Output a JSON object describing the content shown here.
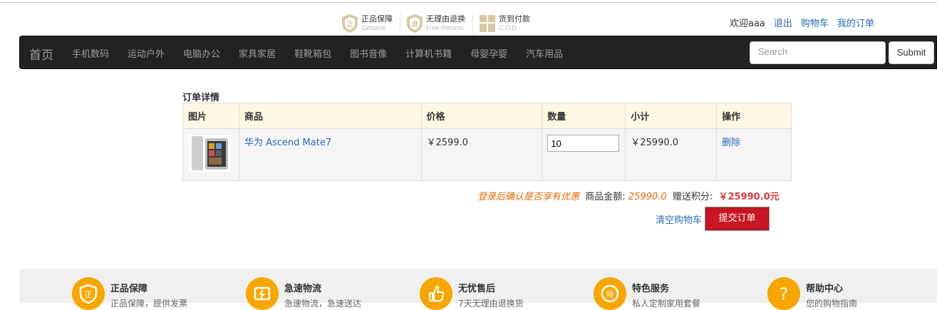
{
  "promises": [
    {
      "icon": "shield-genuine-icon",
      "cn": "正品保障",
      "en": "Genuine"
    },
    {
      "icon": "shield-return-icon",
      "cn": "无理由退换",
      "en": "Free Returns"
    },
    {
      "icon": "gift-cod-icon",
      "cn": "货到付款",
      "en": "C.O.D"
    }
  ],
  "user": {
    "welcome": "欢迎aaa",
    "logout": "退出",
    "cart": "购物车",
    "orders": "我的订单"
  },
  "nav": {
    "brand": "首页",
    "items": [
      "手机数码",
      "运动户外",
      "电脑办公",
      "家具家居",
      "鞋靴箱包",
      "图书音像",
      "计算机书籍",
      "母婴孕婴",
      "汽车用品"
    ],
    "search_placeholder": "Search",
    "submit": "Submit"
  },
  "order": {
    "title": "订单详情",
    "headers": [
      "图片",
      "商品",
      "价格",
      "数量",
      "小计",
      "操作"
    ],
    "rows": [
      {
        "product": "华为 Ascend Mate7",
        "price": "￥2599.0",
        "quantity": "10",
        "subtotal": "￥25990.0",
        "action": "删除"
      }
    ]
  },
  "summary": {
    "promo": "登录后确认是否享有优惠",
    "amount_label": "商品金额:",
    "amount": "25990.0",
    "points_label": "赠送积分:",
    "total": "￥25990.0元"
  },
  "actions": {
    "clear": "清空购物车",
    "submit": "提交订单"
  },
  "footer": [
    {
      "icon": "genuine-icon",
      "title": "正品保障",
      "sub": "正品保障，提供发票"
    },
    {
      "icon": "fast-delivery-icon",
      "title": "急速物流",
      "sub": "急速物流，急速送达"
    },
    {
      "icon": "thumbs-up-icon",
      "title": "无忧售后",
      "sub": "7天无理由退换货"
    },
    {
      "icon": "special-service-icon",
      "title": "特色服务",
      "sub": "私人定制家用套餐"
    },
    {
      "icon": "help-icon",
      "title": "帮助中心",
      "sub": "您的购物指南"
    }
  ],
  "colors": {
    "accent": "#c81623",
    "link": "#2a6bb5",
    "promo": "#e46c0a",
    "navbar": "#222222",
    "footer_icon": "#f7a600"
  }
}
